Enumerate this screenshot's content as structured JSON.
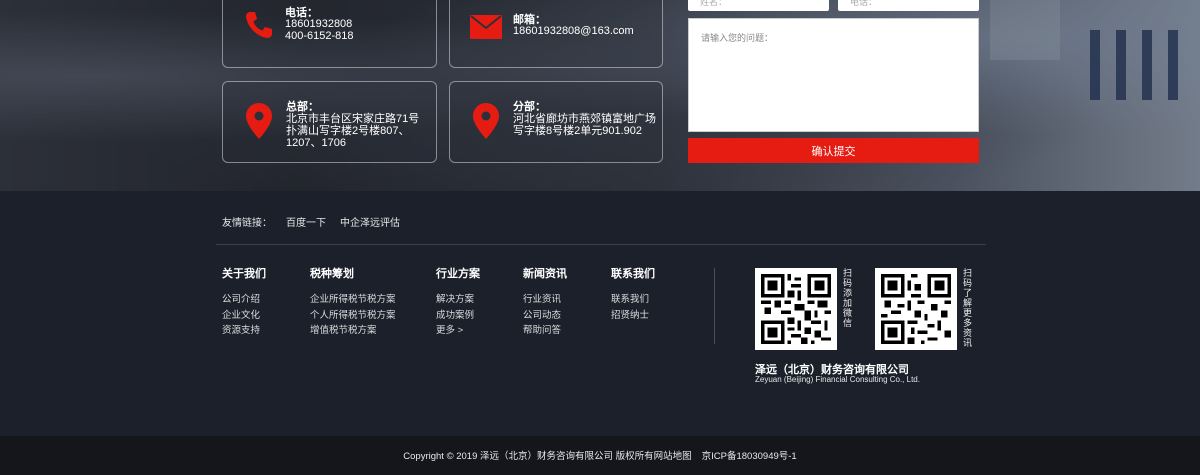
{
  "contact": {
    "phone": {
      "label": "电话：",
      "lines": "18601932808\n400-6152-818"
    },
    "email": {
      "label": "邮箱：",
      "lines": "18601932808@163.com"
    },
    "hq": {
      "label": "总部：",
      "lines": "北京市丰台区宋家庄路71号\n扑满山写字楼2号楼807、\n1207、1706"
    },
    "branch": {
      "label": "分部：",
      "lines": "河北省廊坊市燕郊镇富地广场\n写字楼8号楼2单元901.902"
    }
  },
  "form": {
    "name_placeholder": "姓名：",
    "phone_placeholder": "电话：",
    "question_placeholder": "请输入您的问题：",
    "submit_label": "确认提交"
  },
  "friend_links": {
    "title": "友情链接：",
    "items": [
      "百度一下",
      "中企泽远评估"
    ]
  },
  "footer_nav": [
    {
      "head": "关于我们",
      "items": [
        "公司介绍",
        "企业文化",
        "资源支持"
      ]
    },
    {
      "head": "税种筹划",
      "items": [
        "企业所得税节税方案",
        "个人所得税节税方案",
        "增值税节税方案"
      ]
    },
    {
      "head": "行业方案",
      "items": [
        "解决方案",
        "成功案例",
        "更多 >"
      ]
    },
    {
      "head": "新闻资讯",
      "items": [
        "行业资讯",
        "公司动态",
        "帮助问答"
      ]
    },
    {
      "head": "联系我们",
      "items": [
        "联系我们",
        "招贤纳士"
      ]
    }
  ],
  "qr": {
    "wechat_caption": "扫码添加微信",
    "more_caption": "扫码了解更多资讯"
  },
  "company": {
    "name_cn": "泽远（北京）财务咨询有限公司",
    "name_en": "Zeyuan (Beijing) Financial Consulting Co., Ltd."
  },
  "copyright": {
    "text": "Copyright © 2019 泽远（北京）财务咨询有限公司 版权所有",
    "sitemap": "网站地图",
    "icp": "京ICP备18030949号-1"
  },
  "colors": {
    "accent": "#e61c12",
    "footer_bg": "#1b202b",
    "bottom_bar": "#14161b"
  }
}
